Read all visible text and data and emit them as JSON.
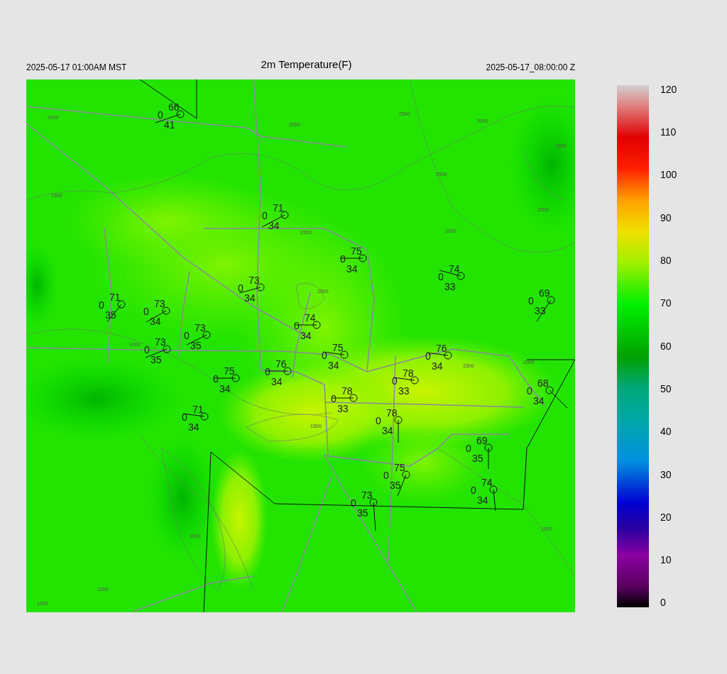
{
  "header": {
    "local_time": "2025-05-17 01:00AM MST",
    "title": "2m Temperature(F)",
    "valid_time": "2025-05-17_08:00:00 Z"
  },
  "contour_labels": [
    "2000",
    "2000",
    "2500",
    "3000",
    "3500",
    "2500",
    "2500",
    "2000",
    "1500",
    "1500",
    "1500",
    "1000",
    "1500",
    "1500",
    "2000",
    "1500",
    "1500",
    "1500",
    "1500"
  ],
  "stations": [
    {
      "temp": "66",
      "value": "0",
      "dewpoint": "41"
    },
    {
      "temp": "71",
      "value": "0",
      "dewpoint": "34"
    },
    {
      "temp": "75",
      "value": "0",
      "dewpoint": "34"
    },
    {
      "temp": "74",
      "value": "0",
      "dewpoint": "33"
    },
    {
      "temp": "73",
      "value": "0",
      "dewpoint": "34"
    },
    {
      "temp": "71",
      "value": "0",
      "dewpoint": "35"
    },
    {
      "temp": "73",
      "value": "0",
      "dewpoint": "34"
    },
    {
      "temp": "69",
      "value": "0",
      "dewpoint": "33"
    },
    {
      "temp": "74",
      "value": "0",
      "dewpoint": "34"
    },
    {
      "temp": "73",
      "value": "0",
      "dewpoint": "35"
    },
    {
      "temp": "73",
      "value": "0",
      "dewpoint": "35"
    },
    {
      "temp": "75",
      "value": "0",
      "dewpoint": "34"
    },
    {
      "temp": "76",
      "value": "0",
      "dewpoint": "34"
    },
    {
      "temp": "76",
      "value": "0",
      "dewpoint": "34"
    },
    {
      "temp": "75",
      "value": "0",
      "dewpoint": "34"
    },
    {
      "temp": "78",
      "value": "0",
      "dewpoint": "33"
    },
    {
      "temp": "78",
      "value": "0",
      "dewpoint": "33"
    },
    {
      "temp": "68",
      "value": "0",
      "dewpoint": "34"
    },
    {
      "temp": "71",
      "value": "0",
      "dewpoint": "34"
    },
    {
      "temp": "78",
      "value": "0",
      "dewpoint": "34"
    },
    {
      "temp": "69",
      "value": "0",
      "dewpoint": "35"
    },
    {
      "temp": "75",
      "value": "0",
      "dewpoint": "35"
    },
    {
      "temp": "73",
      "value": "0",
      "dewpoint": "35"
    },
    {
      "temp": "74",
      "value": "0",
      "dewpoint": "34"
    }
  ],
  "colorbar": {
    "ticks": [
      "120",
      "110",
      "100",
      "90",
      "80",
      "70",
      "60",
      "50",
      "40",
      "30",
      "20",
      "10",
      "0"
    ]
  }
}
